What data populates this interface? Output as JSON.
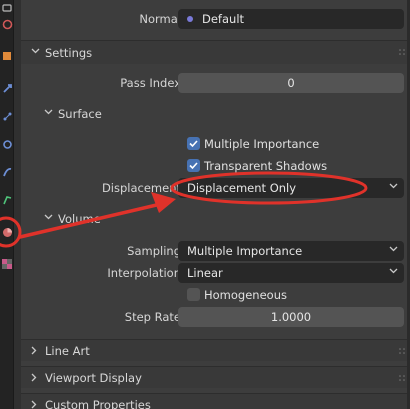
{
  "top_field": {
    "label": "Normal",
    "value": "Default"
  },
  "settings": {
    "title": "Settings",
    "pass_index": {
      "label": "Pass Index",
      "value": "0"
    }
  },
  "surface": {
    "title": "Surface",
    "multiple_importance": {
      "label": "Multiple Importance",
      "checked": true
    },
    "transparent_shadows": {
      "label": "Transparent Shadows",
      "checked": true
    },
    "displacement": {
      "label": "Displacement",
      "value": "Displacement Only"
    }
  },
  "volume": {
    "title": "Volume",
    "sampling": {
      "label": "Sampling",
      "value": "Multiple Importance"
    },
    "interpolation": {
      "label": "Interpolation",
      "value": "Linear"
    },
    "homogeneous": {
      "label": "Homogeneous",
      "checked": false
    },
    "step_rate": {
      "label": "Step Rate",
      "value": "1.0000"
    }
  },
  "collapsed_panels": [
    "Line Art",
    "Viewport Display",
    "Custom Properties"
  ],
  "annotation": {
    "color": "#e0322a"
  },
  "colors": {
    "checkbox_accent": "#4772b3",
    "material_dot": "#7a7ad9"
  },
  "toolbar_icons": [
    "render-icon",
    "output-icon",
    "view-layer-icon",
    "scene-icon",
    "world-icon",
    "object-icon",
    "modifier-icon",
    "particles-icon",
    "physics-icon",
    "constraints-icon",
    "object-data-icon",
    "material-icon",
    "texture-icon"
  ]
}
